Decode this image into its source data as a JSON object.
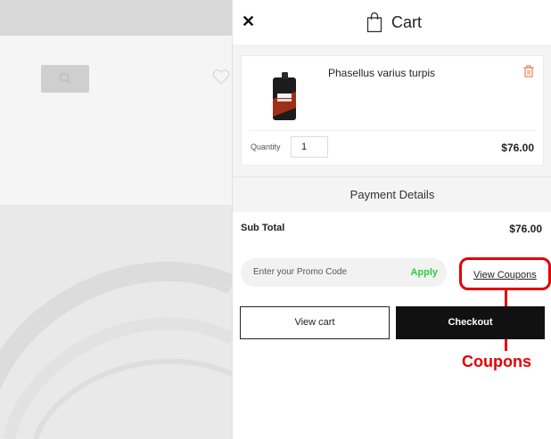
{
  "drawer": {
    "title": "Cart",
    "close_icon": "close-icon",
    "bag_icon": "shopping-bag-icon"
  },
  "cart_item": {
    "name": "Phasellus varius turpis",
    "quantity_label": "Quantity",
    "quantity": "1",
    "price": "$76.00",
    "delete_icon": "trash-icon"
  },
  "payment": {
    "header": "Payment Details",
    "subtotal_label": "Sub Total",
    "subtotal_value": "$76.00"
  },
  "promo": {
    "placeholder": "Enter your Promo Code",
    "apply_label": "Apply",
    "view_coupons_label": "View Coupons"
  },
  "actions": {
    "view_cart_label": "View cart",
    "checkout_label": "Checkout"
  },
  "annotation": {
    "label": "Coupons"
  },
  "colors": {
    "accent_green": "#2ecc40",
    "annotation_red": "#e30000",
    "checkout_bg": "#111111",
    "trash_orange": "#e8734a"
  }
}
